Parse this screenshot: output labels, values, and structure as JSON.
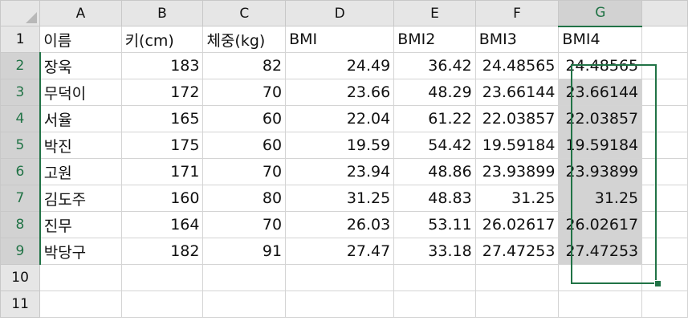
{
  "columns": [
    "A",
    "B",
    "C",
    "D",
    "E",
    "F",
    "G"
  ],
  "rows": [
    "1",
    "2",
    "3",
    "4",
    "5",
    "6",
    "7",
    "8",
    "9",
    "10",
    "11"
  ],
  "headers": {
    "A": "이름",
    "B": "키(cm)",
    "C": "체중(kg)",
    "D": "BMI",
    "E": "BMI2",
    "F": "BMI3",
    "G": "BMI4"
  },
  "records": [
    {
      "name": "장욱",
      "height": "183",
      "weight": "82",
      "bmi": "24.49",
      "bmi2": "36.42",
      "bmi3": "24.48565",
      "bmi4": "24.48565"
    },
    {
      "name": "무덕이",
      "height": "172",
      "weight": "70",
      "bmi": "23.66",
      "bmi2": "48.29",
      "bmi3": "23.66144",
      "bmi4": "23.66144"
    },
    {
      "name": "서율",
      "height": "165",
      "weight": "60",
      "bmi": "22.04",
      "bmi2": "61.22",
      "bmi3": "22.03857",
      "bmi4": "22.03857"
    },
    {
      "name": "박진",
      "height": "175",
      "weight": "60",
      "bmi": "19.59",
      "bmi2": "54.42",
      "bmi3": "19.59184",
      "bmi4": "19.59184"
    },
    {
      "name": "고원",
      "height": "171",
      "weight": "70",
      "bmi": "23.94",
      "bmi2": "48.86",
      "bmi3": "23.93899",
      "bmi4": "23.93899"
    },
    {
      "name": "김도주",
      "height": "160",
      "weight": "80",
      "bmi": "31.25",
      "bmi2": "48.83",
      "bmi3": "31.25",
      "bmi4": "31.25"
    },
    {
      "name": "진무",
      "height": "164",
      "weight": "70",
      "bmi": "26.03",
      "bmi2": "53.11",
      "bmi3": "26.02617",
      "bmi4": "26.02617"
    },
    {
      "name": "박당구",
      "height": "182",
      "weight": "91",
      "bmi": "27.47",
      "bmi2": "33.18",
      "bmi3": "27.47253",
      "bmi4": "27.47253"
    }
  ],
  "selection": {
    "range": "G2:G9",
    "active_cell": "G2",
    "selected_column": "G",
    "accent_color": "#217346"
  }
}
